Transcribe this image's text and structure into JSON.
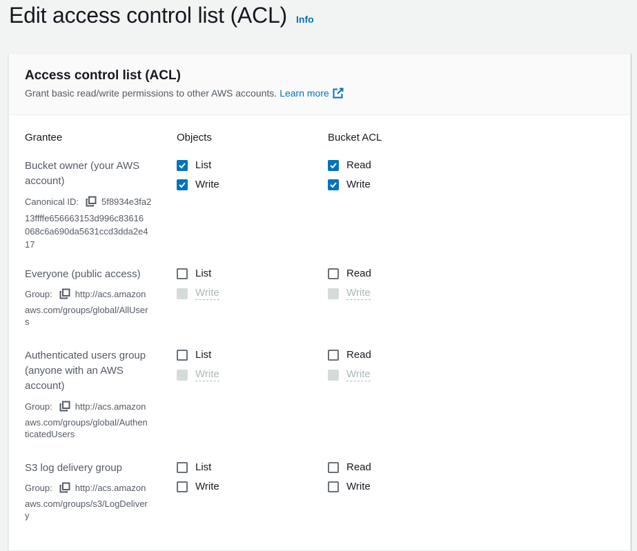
{
  "page": {
    "title": "Edit access control list (ACL)",
    "info_label": "Info"
  },
  "panel": {
    "title": "Access control list (ACL)",
    "description": "Grant basic read/write permissions to other AWS accounts.",
    "learn_more": "Learn more"
  },
  "columns": {
    "grantee": "Grantee",
    "objects": "Objects",
    "bucket_acl": "Bucket ACL"
  },
  "grantees": [
    {
      "name_lines": [
        "Bucket owner (your AWS",
        "account)"
      ],
      "id_label": "Canonical ID:",
      "id_lines": [
        "5f8934e3fa2",
        "13ffffe656663153d996c83616",
        "068c6a690da5631ccd3dda2e4",
        "17"
      ],
      "objects": [
        {
          "label": "List",
          "checked": true,
          "disabled": false
        },
        {
          "label": "Write",
          "checked": true,
          "disabled": false
        }
      ],
      "bucket_acl": [
        {
          "label": "Read",
          "checked": true,
          "disabled": false
        },
        {
          "label": "Write",
          "checked": true,
          "disabled": false
        }
      ]
    },
    {
      "name_lines": [
        "Everyone (public access)"
      ],
      "id_label": "Group:",
      "id_lines": [
        "http://acs.amazon",
        "aws.com/groups/global/AllUser",
        "s"
      ],
      "objects": [
        {
          "label": "List",
          "checked": false,
          "disabled": false
        },
        {
          "label": "Write",
          "checked": false,
          "disabled": true
        }
      ],
      "bucket_acl": [
        {
          "label": "Read",
          "checked": false,
          "disabled": false
        },
        {
          "label": "Write",
          "checked": false,
          "disabled": true
        }
      ]
    },
    {
      "name_lines": [
        "Authenticated users group",
        "(anyone with an AWS",
        "account)"
      ],
      "id_label": "Group:",
      "id_lines": [
        "http://acs.amazon",
        "aws.com/groups/global/Authen",
        "ticatedUsers"
      ],
      "objects": [
        {
          "label": "List",
          "checked": false,
          "disabled": false
        },
        {
          "label": "Write",
          "checked": false,
          "disabled": true
        }
      ],
      "bucket_acl": [
        {
          "label": "Read",
          "checked": false,
          "disabled": false
        },
        {
          "label": "Write",
          "checked": false,
          "disabled": true
        }
      ]
    },
    {
      "name_lines": [
        "S3 log delivery group"
      ],
      "id_label": "Group:",
      "id_lines": [
        "http://acs.amazon",
        "aws.com/groups/s3/LogDeliver",
        "y"
      ],
      "objects": [
        {
          "label": "List",
          "checked": false,
          "disabled": false
        },
        {
          "label": "Write",
          "checked": false,
          "disabled": false
        }
      ],
      "bucket_acl": [
        {
          "label": "Read",
          "checked": false,
          "disabled": false
        },
        {
          "label": "Write",
          "checked": false,
          "disabled": false
        }
      ]
    }
  ],
  "colors": {
    "link": "#0073bb",
    "checkbox_checked": "#0073bb",
    "disabled": "#aab7b8"
  }
}
